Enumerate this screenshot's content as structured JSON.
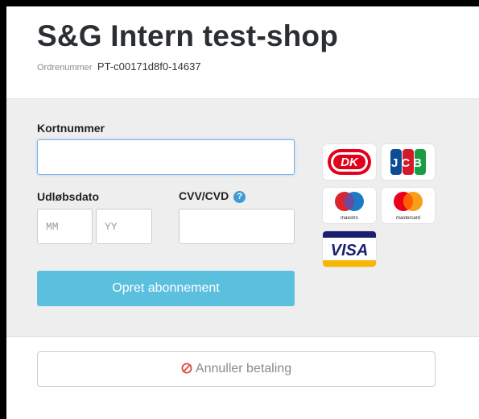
{
  "header": {
    "shop_title": "S&G Intern test-shop",
    "order_label": "Ordrenummer",
    "order_number": "PT-c00171d8f0-14637"
  },
  "form": {
    "card_number_label": "Kortnummer",
    "card_number_value": "",
    "expiry_label": "Udløbsdato",
    "month_placeholder": "MM",
    "year_placeholder": "YY",
    "cvv_label": "CVV/CVD",
    "help_glyph": "?",
    "submit_label": "Opret abonnement"
  },
  "logos": {
    "maestro_text": "maestro",
    "mastercard_text": "mastercard",
    "visa_text": "VISA",
    "jcb_text": "JCB",
    "dankort_text": "DK"
  },
  "footer": {
    "cancel_label": "Annuller betaling"
  },
  "colors": {
    "submit_bg": "#5bc0de",
    "help_icon": "#3d9bd5",
    "cancel_icon": "#e0493f",
    "panel_bg": "#eeeeee"
  },
  "icons": {
    "help": "question-circle-icon",
    "cancel": "ban-icon"
  }
}
